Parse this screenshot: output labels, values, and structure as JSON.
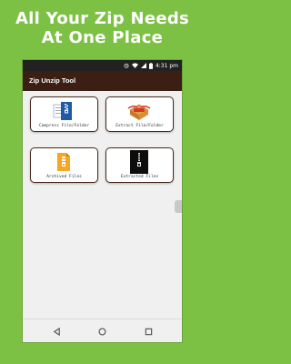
{
  "headline": {
    "line1": "All Your Zip Needs",
    "line2": "At One Place"
  },
  "status_bar": {
    "time": "4:31 pm",
    "icons": [
      "alarm-icon",
      "wifi-icon",
      "signal-icon",
      "battery-icon"
    ]
  },
  "app_bar": {
    "title": "Zip Unzip Tool"
  },
  "cards": [
    {
      "label": "Compress File/Folder",
      "icon": "compress-document-icon"
    },
    {
      "label": "Extract File/Folder",
      "icon": "extract-package-icon"
    },
    {
      "label": "Archived Files",
      "icon": "archive-file-icon"
    },
    {
      "label": "Extracted Files",
      "icon": "zip-archive-icon"
    }
  ],
  "nav_bar": {
    "buttons": [
      "back-icon",
      "home-icon",
      "recents-icon"
    ]
  },
  "colors": {
    "background": "#7dc144",
    "app_bar": "#3b1f14",
    "status_bar": "#212121",
    "card_border": "#4a2a1c"
  }
}
